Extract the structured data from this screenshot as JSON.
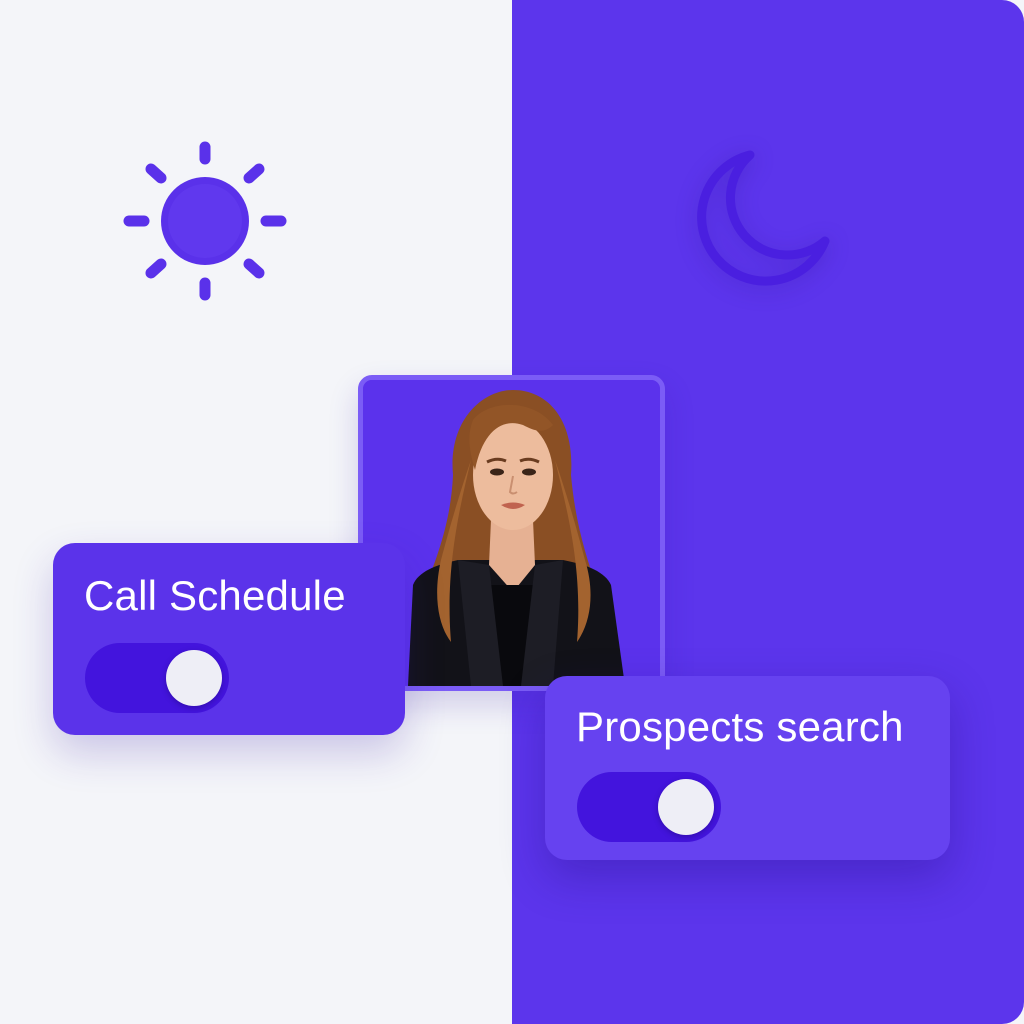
{
  "theme": {
    "light_background": "#f4f5f9",
    "dark_background": "#5c35ec",
    "accent": "#5a31ea",
    "toggle_track": "#4314dd",
    "toggle_knob": "#eeeef6"
  },
  "icons": {
    "light_mode": "sun-icon",
    "dark_mode": "moon-icon"
  },
  "profile": {
    "image": "portrait-photo"
  },
  "settings": [
    {
      "label": "Call Schedule",
      "enabled": true
    },
    {
      "label": "Prospects search",
      "enabled": true
    }
  ]
}
